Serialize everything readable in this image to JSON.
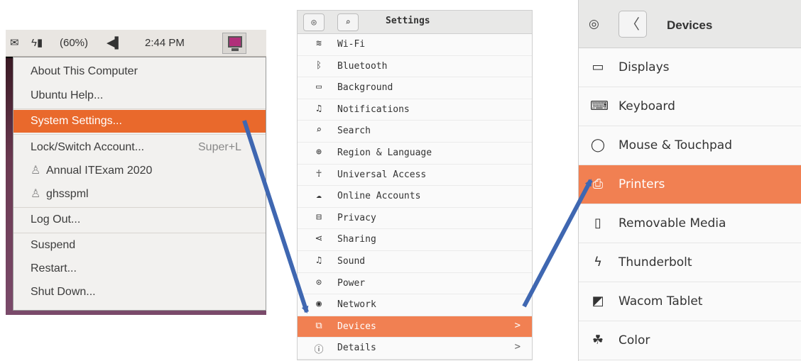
{
  "top_panel": {
    "indicators": {
      "mail_icon": "mail-icon",
      "battery_icon": "battery-icon",
      "battery_text": "(60%)",
      "volume_icon": "volume-icon",
      "clock": "2:44 PM",
      "power_icon": "power-menu-icon"
    },
    "menu": {
      "items": [
        {
          "label": "About This Computer"
        },
        {
          "label": "Ubuntu Help..."
        },
        {
          "label": "System Settings...",
          "selected": true
        },
        {
          "label": "Lock/Switch Account...",
          "shortcut": "Super+L"
        },
        {
          "label": "Annual ITExam 2020",
          "icon": "user-icon"
        },
        {
          "label": "ghsspml",
          "icon": "user-icon"
        },
        {
          "label": "Log Out..."
        },
        {
          "label": "Suspend"
        },
        {
          "label": "Restart..."
        },
        {
          "label": "Shut Down..."
        }
      ]
    }
  },
  "settings": {
    "title": "Settings",
    "items": [
      {
        "label": "Wi-Fi",
        "icon": "wifi-icon"
      },
      {
        "label": "Bluetooth",
        "icon": "bluetooth-icon"
      },
      {
        "label": "Background",
        "icon": "background-icon"
      },
      {
        "label": "Notifications",
        "icon": "bell-icon"
      },
      {
        "label": "Search",
        "icon": "search-icon"
      },
      {
        "label": "Region & Language",
        "icon": "globe-icon"
      },
      {
        "label": "Universal Access",
        "icon": "accessibility-icon"
      },
      {
        "label": "Online Accounts",
        "icon": "cloud-icon"
      },
      {
        "label": "Privacy",
        "icon": "lock-icon"
      },
      {
        "label": "Sharing",
        "icon": "share-icon"
      },
      {
        "label": "Sound",
        "icon": "music-note-icon"
      },
      {
        "label": "Power",
        "icon": "power-icon"
      },
      {
        "label": "Network",
        "icon": "network-icon"
      },
      {
        "label": "Devices",
        "icon": "devices-icon",
        "selected": true,
        "chevron": ">"
      },
      {
        "label": "Details",
        "icon": "info-icon",
        "chevron": ">"
      }
    ]
  },
  "devices": {
    "title": "Devices",
    "back": "〈",
    "items": [
      {
        "label": "Displays",
        "icon": "display-icon"
      },
      {
        "label": "Keyboard",
        "icon": "keyboard-icon"
      },
      {
        "label": "Mouse & Touchpad",
        "icon": "mouse-icon"
      },
      {
        "label": "Printers",
        "icon": "printer-icon",
        "selected": true
      },
      {
        "label": "Removable Media",
        "icon": "removable-media-icon"
      },
      {
        "label": "Thunderbolt",
        "icon": "thunderbolt-icon"
      },
      {
        "label": "Wacom Tablet",
        "icon": "tablet-icon"
      },
      {
        "label": "Color",
        "icon": "color-icon"
      }
    ]
  },
  "colors": {
    "highlight": "#f18052",
    "menu_highlight": "#e9692c",
    "arrow": "#3f67b1"
  }
}
